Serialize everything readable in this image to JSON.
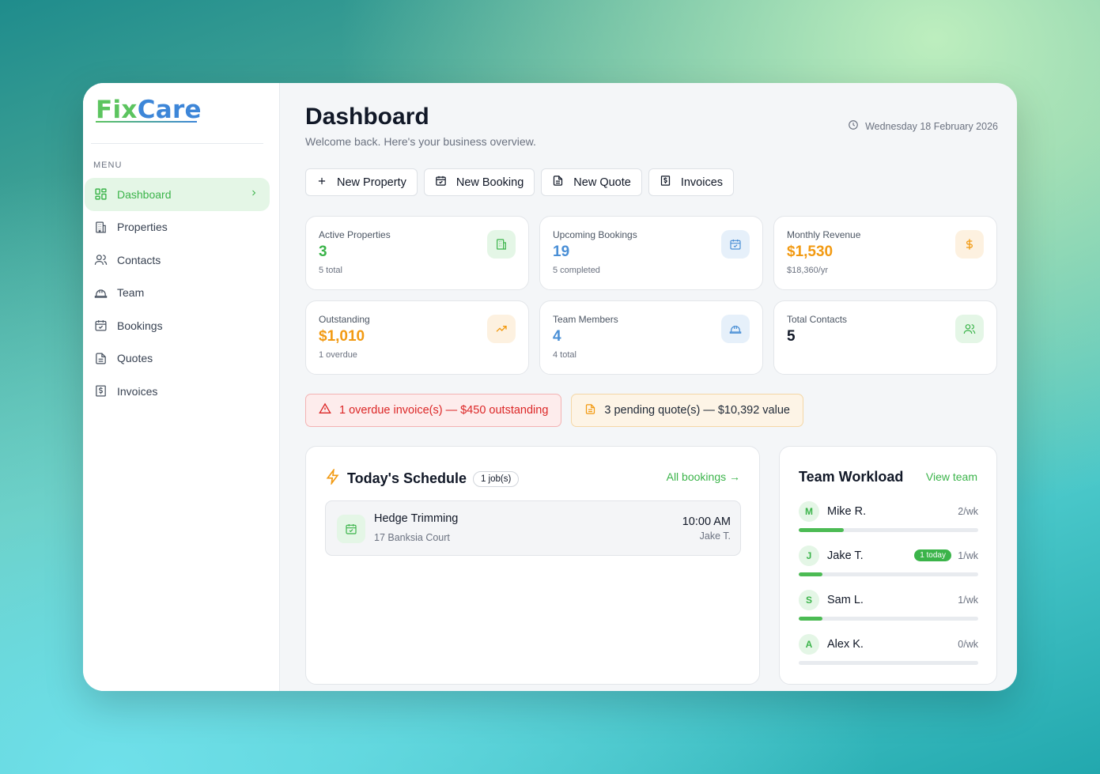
{
  "brand": {
    "part1": "Fix",
    "part2": "Care"
  },
  "sidebar": {
    "menu_label": "MENU",
    "items": [
      {
        "label": "Dashboard",
        "icon": "layout-grid-icon",
        "active": true
      },
      {
        "label": "Properties",
        "icon": "building-icon"
      },
      {
        "label": "Contacts",
        "icon": "users-icon"
      },
      {
        "label": "Team",
        "icon": "hard-hat-icon"
      },
      {
        "label": "Bookings",
        "icon": "calendar-check-icon"
      },
      {
        "label": "Quotes",
        "icon": "file-text-icon"
      },
      {
        "label": "Invoices",
        "icon": "receipt-dollar-icon"
      }
    ]
  },
  "header": {
    "title": "Dashboard",
    "subtitle": "Welcome back. Here's your business overview.",
    "date": "Wednesday 18 February 2026"
  },
  "actions": {
    "new_property": "New Property",
    "new_booking": "New Booking",
    "new_quote": "New Quote",
    "invoices": "Invoices"
  },
  "stats": [
    {
      "label": "Active Properties",
      "value": "3",
      "sub": "5 total",
      "color": "#3bb44a",
      "icon": "building-icon"
    },
    {
      "label": "Upcoming Bookings",
      "value": "19",
      "sub": "5 completed",
      "color": "#4a8fd6",
      "icon": "calendar-check-icon"
    },
    {
      "label": "Monthly Revenue",
      "value": "$1,530",
      "sub": "$18,360/yr",
      "color": "#f29a12",
      "icon": "dollar-icon"
    },
    {
      "label": "Outstanding",
      "value": "$1,010",
      "sub": "1 overdue",
      "color": "#f29a12",
      "icon": "trending-up-icon"
    },
    {
      "label": "Team Members",
      "value": "4",
      "sub": "4 total",
      "color": "#4a8fd6",
      "icon": "hard-hat-icon"
    },
    {
      "label": "Total Contacts",
      "value": "5",
      "sub": "",
      "color": "#111827",
      "icon": "users-icon"
    }
  ],
  "alerts": {
    "overdue": "1 overdue invoice(s) — $450 outstanding",
    "pending": "3 pending quote(s) — $10,392 value"
  },
  "schedule": {
    "title": "Today's Schedule",
    "count": "1 job(s)",
    "link": "All bookings →",
    "jobs": [
      {
        "name": "Hedge Trimming",
        "address": "17 Banksia Court",
        "time": "10:00 AM",
        "assignee": "Jake T."
      }
    ]
  },
  "workload": {
    "title": "Team Workload",
    "link": "View team",
    "members": [
      {
        "initial": "M",
        "name": "Mike R.",
        "rate": "2/wk",
        "today": "",
        "load": 0.25
      },
      {
        "initial": "J",
        "name": "Jake T.",
        "rate": "1/wk",
        "today": "1 today",
        "load": 0.13
      },
      {
        "initial": "S",
        "name": "Sam L.",
        "rate": "1/wk",
        "today": "",
        "load": 0.13
      },
      {
        "initial": "A",
        "name": "Alex K.",
        "rate": "0/wk",
        "today": "",
        "load": 0
      }
    ]
  }
}
